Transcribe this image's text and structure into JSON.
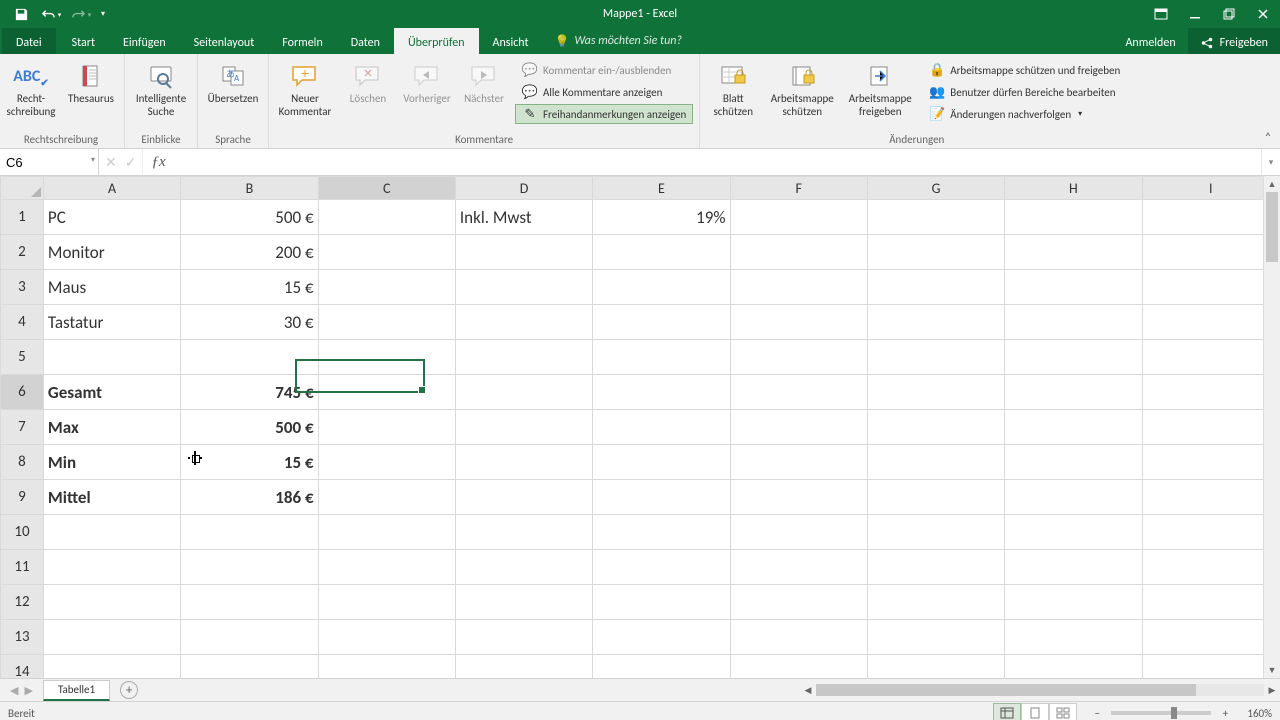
{
  "app": {
    "title": "Mappe1 - Excel"
  },
  "qat": {
    "save_title": "Speichern",
    "undo_title": "Rückgängig",
    "redo_title": "Wiederholen"
  },
  "window": {
    "signin": "Anmelden",
    "share": "Freigeben"
  },
  "tabs": {
    "file": "Datei",
    "home": "Start",
    "insert": "Einfügen",
    "pagelayout": "Seitenlayout",
    "formulas": "Formeln",
    "data": "Daten",
    "review": "Überprüfen",
    "view": "Ansicht",
    "tellme": "Was möchten Sie tun?"
  },
  "ribbon": {
    "proofing": {
      "spelling": "Recht-\nschreibung",
      "thesaurus": "Thesaurus",
      "title": "Rechtschreibung"
    },
    "insights": {
      "smart": "Intelligente\nSuche",
      "title": "Einblicke"
    },
    "language": {
      "translate": "Übersetzen",
      "title": "Sprache"
    },
    "comments": {
      "new": "Neuer\nKommentar",
      "delete": "Löschen",
      "previous": "Vorheriger",
      "next": "Nächster",
      "toggle": "Kommentar ein-/ausblenden",
      "showall": "Alle Kommentare anzeigen",
      "ink": "Freihandanmerkungen anzeigen",
      "title": "Kommentare"
    },
    "protect": {
      "sheet": "Blatt\nschützen",
      "workbook": "Arbeitsmappe\nschützen",
      "share": "Arbeitsmappe\nfreigeben",
      "protectshare": "Arbeitsmappe schützen und freigeben",
      "allowedit": "Benutzer dürfen Bereiche bearbeiten",
      "track": "Änderungen nachverfolgen",
      "title": "Änderungen"
    }
  },
  "namebox": {
    "value": "C6"
  },
  "columns": [
    "A",
    "B",
    "C",
    "D",
    "E",
    "F",
    "G",
    "H",
    "I"
  ],
  "rows": [
    "1",
    "2",
    "3",
    "4",
    "5",
    "6",
    "7",
    "8",
    "9",
    "10",
    "11",
    "12",
    "13",
    "14"
  ],
  "selected": {
    "col": "C",
    "row": "6"
  },
  "cells": {
    "A1": "PC",
    "B1": "500 €",
    "D1": "Inkl. Mwst",
    "E1": "19%",
    "A2": "Monitor",
    "B2": "200 €",
    "A3": "Maus",
    "B3": "15 €",
    "A4": "Tastatur",
    "B4": "30 €",
    "A6": "Gesamt",
    "B6": "745 €",
    "A7": "Max",
    "B7": "500 €",
    "A8": "Min",
    "B8": "15 €",
    "A9": "Mittel",
    "B9": "186 €"
  },
  "bold_cells": [
    "A6",
    "B6",
    "A7",
    "B7",
    "A8",
    "B8",
    "A9",
    "B9"
  ],
  "sheet_tabs": {
    "name": "Tabelle1"
  },
  "status": {
    "ready": "Bereit",
    "zoom": "160%"
  }
}
